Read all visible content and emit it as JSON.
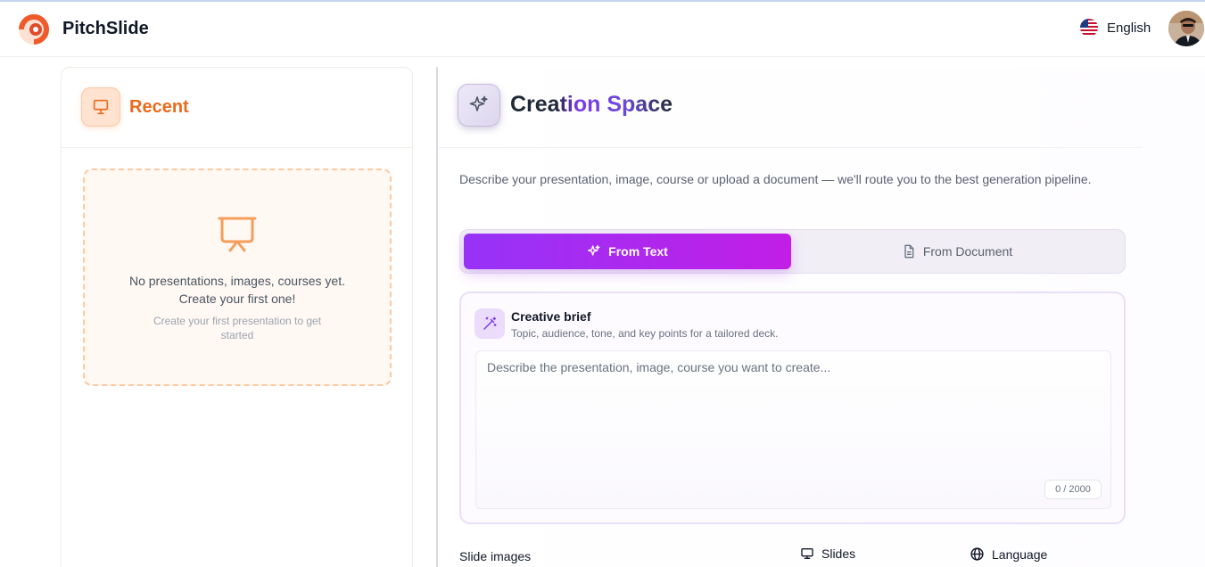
{
  "header": {
    "app_name": "PitchSlide",
    "language": "English"
  },
  "recent": {
    "title": "Recent",
    "empty_title": "No presentations, images, courses yet. Create your first one!",
    "empty_subtitle": "Create your first presentation to get started"
  },
  "creation": {
    "title": "Creation Space",
    "description": "Describe your presentation, image, course or upload a document — we'll route you to the best generation pipeline.",
    "tabs": {
      "from_text": "From Text",
      "from_document": "From Document"
    },
    "brief": {
      "title": "Creative brief",
      "subtitle": "Topic, audience, tone, and key points for a tailored deck.",
      "placeholder": "Describe the presentation, image, course you want to create...",
      "counter": "0 / 2000"
    },
    "options": {
      "slide_images": "Slide images",
      "slides": "Slides",
      "language": "Language"
    }
  },
  "colors": {
    "brand_orange": "#ea6a1c",
    "accent_purple_start": "#9633f7",
    "accent_purple_end": "#c21ee6"
  }
}
